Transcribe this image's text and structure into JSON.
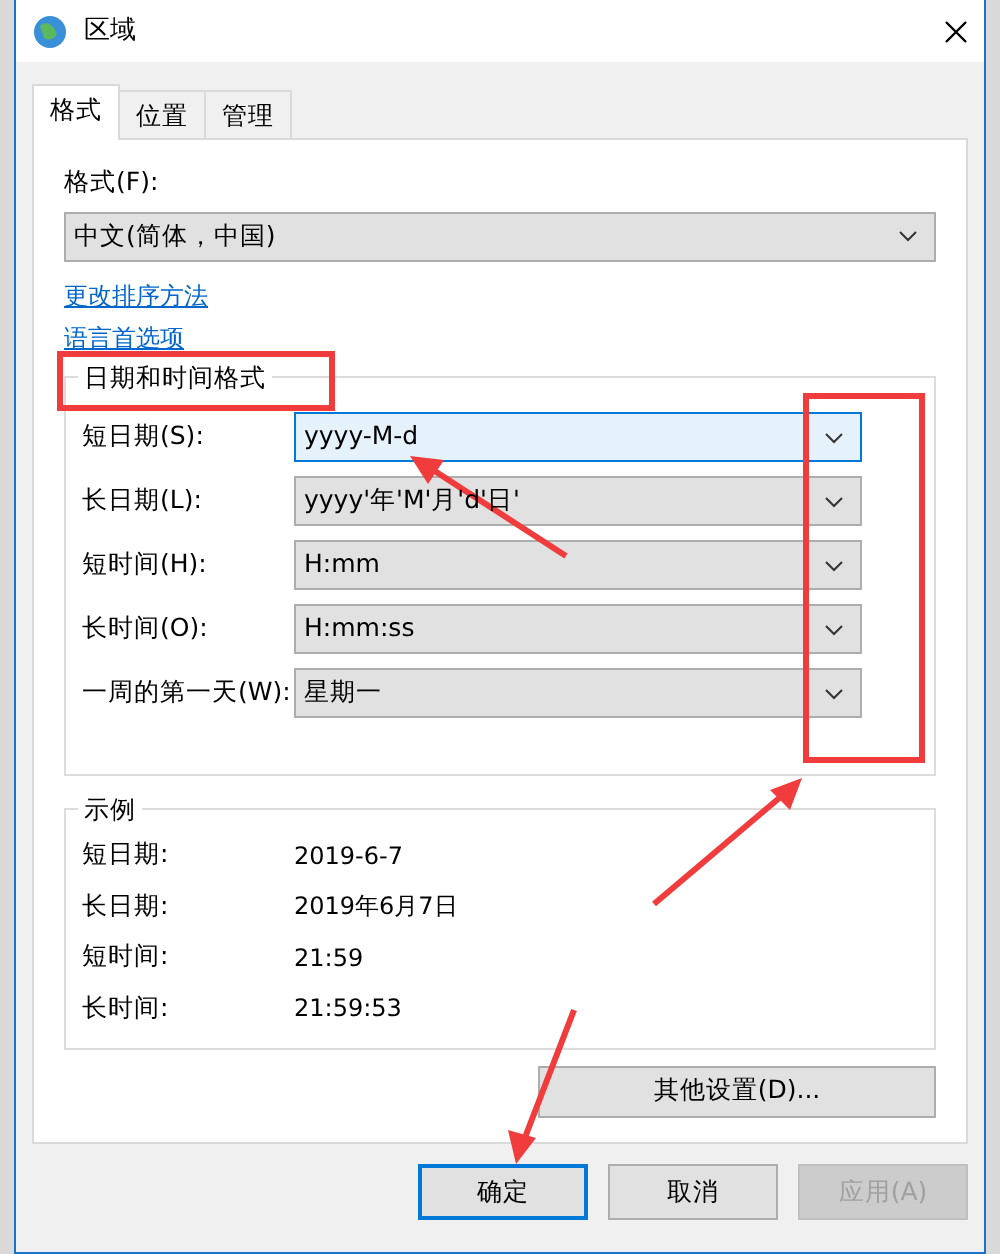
{
  "window": {
    "title": "区域"
  },
  "tabs": [
    {
      "label": "格式",
      "selected": true
    },
    {
      "label": "位置",
      "selected": false
    },
    {
      "label": "管理",
      "selected": false
    }
  ],
  "format": {
    "label": "格式(F):",
    "value": "中文(简体，中国)"
  },
  "links": [
    "更改排序方法",
    "语言首选项"
  ],
  "date_time_formats": {
    "title": "日期和时间格式",
    "rows": [
      {
        "label": "短日期(S):",
        "value": "yyyy-M-d",
        "focused": true
      },
      {
        "label": "长日期(L):",
        "value": "yyyy'年'M'月'd'日'",
        "focused": false
      },
      {
        "label": "短时间(H):",
        "value": "H:mm",
        "focused": false
      },
      {
        "label": "长时间(O):",
        "value": "H:mm:ss",
        "focused": false
      },
      {
        "label": "一周的第一天(W):",
        "value": "星期一",
        "focused": false
      }
    ]
  },
  "examples": {
    "title": "示例",
    "rows": [
      {
        "label": "短日期:",
        "value": "2019-6-7"
      },
      {
        "label": "长日期:",
        "value": "2019年6月7日"
      },
      {
        "label": "短时间:",
        "value": "21:59"
      },
      {
        "label": "长时间:",
        "value": "21:59:53"
      }
    ]
  },
  "other_settings_button": "其他设置(D)...",
  "buttons": [
    {
      "label": "确定",
      "default": true,
      "disabled": false
    },
    {
      "label": "取消",
      "default": false,
      "disabled": false
    },
    {
      "label": "应用(A)",
      "default": false,
      "disabled": true
    }
  ]
}
